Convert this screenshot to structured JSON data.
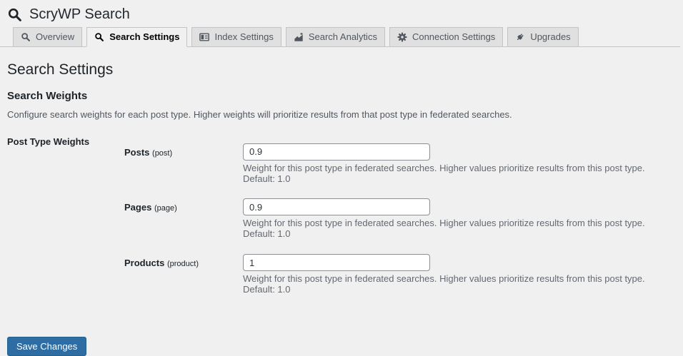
{
  "header": {
    "title": "ScryWP Search"
  },
  "tabs": {
    "items": [
      {
        "label": "Overview",
        "icon": "search-icon",
        "active": false
      },
      {
        "label": "Search Settings",
        "icon": "search-icon",
        "active": true
      },
      {
        "label": "Index Settings",
        "icon": "table-icon",
        "active": false
      },
      {
        "label": "Search Analytics",
        "icon": "chart-icon",
        "active": false
      },
      {
        "label": "Connection Settings",
        "icon": "gear-icon",
        "active": false
      },
      {
        "label": "Upgrades",
        "icon": "plugin-icon",
        "active": false
      }
    ]
  },
  "main": {
    "page_title": "Search Settings",
    "section": {
      "title": "Search Weights",
      "description": "Configure search weights for each post type. Higher weights will prioritize results from that post type in federated searches."
    },
    "form": {
      "group_label": "Post Type Weights",
      "rows": [
        {
          "label": "Posts",
          "slug": "(post)",
          "value": "0.9",
          "help": "Weight for this post type in federated searches. Higher values prioritize results from this post type. Default: 1.0"
        },
        {
          "label": "Pages",
          "slug": "(page)",
          "value": "0.9",
          "help": "Weight for this post type in federated searches. Higher values prioritize results from this post type. Default: 1.0"
        },
        {
          "label": "Products",
          "slug": "(product)",
          "value": "1",
          "help": "Weight for this post type in federated searches. Higher values prioritize results from this post type. Default: 1.0"
        }
      ]
    },
    "save_button": "Save Changes"
  },
  "colors": {
    "page_background": "#f0f0f1",
    "tab_border": "#c3c4c7",
    "inactive_tab_background": "#e0e0e1",
    "input_border": "#8c8f94",
    "primary_button": "#2e6da4",
    "help_text": "#646970"
  }
}
